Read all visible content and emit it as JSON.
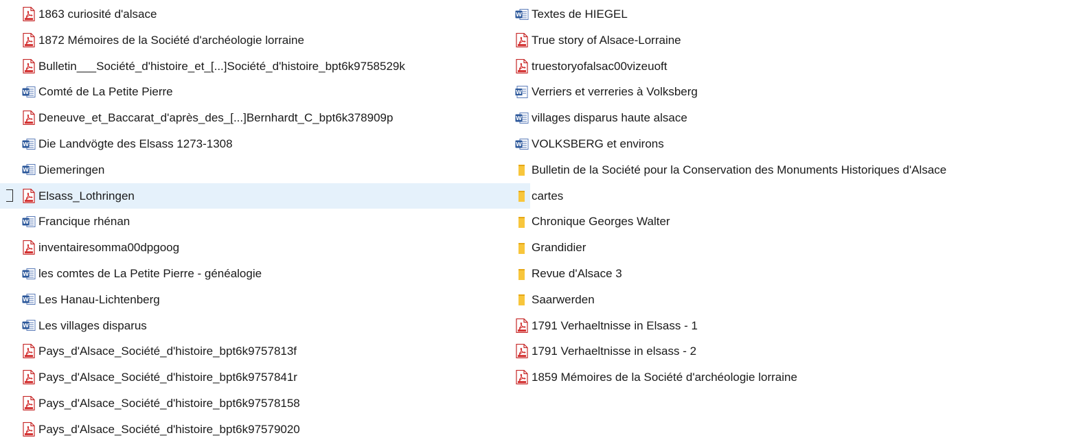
{
  "left_column": [
    {
      "name": "1863 curiosité d'alsace",
      "type": "pdf",
      "icon": "pdf-icon"
    },
    {
      "name": "1872 Mémoires de la Société d'archéologie lorraine",
      "type": "pdf",
      "icon": "pdf-icon"
    },
    {
      "name": "Bulletin___Société_d'histoire_et_[...]Société_d'histoire_bpt6k9758529k",
      "type": "pdf",
      "icon": "pdf-icon"
    },
    {
      "name": "Comté de La Petite Pierre",
      "type": "word",
      "icon": "word-icon"
    },
    {
      "name": "Deneuve_et_Baccarat_d'après_des_[...]Bernhardt_C_bpt6k378909p",
      "type": "pdf",
      "icon": "pdf-icon"
    },
    {
      "name": "Die Landvögte des Elsass 1273-1308",
      "type": "word",
      "icon": "word-icon"
    },
    {
      "name": "Diemeringen",
      "type": "word",
      "icon": "word-icon"
    },
    {
      "name": "Elsass_Lothringen",
      "type": "pdf",
      "icon": "pdf-icon",
      "selected": true
    },
    {
      "name": "Francique rhénan",
      "type": "word",
      "icon": "word-icon"
    },
    {
      "name": "inventairesomma00dpgoog",
      "type": "pdf",
      "icon": "pdf-icon"
    },
    {
      "name": "les comtes de La Petite Pierre - généalogie",
      "type": "word",
      "icon": "word-icon"
    },
    {
      "name": "Les Hanau-Lichtenberg",
      "type": "word",
      "icon": "word-icon"
    },
    {
      "name": "Les villages disparus",
      "type": "word",
      "icon": "word-icon"
    },
    {
      "name": "Pays_d'Alsace_Société_d'histoire_bpt6k9757813f",
      "type": "pdf",
      "icon": "pdf-icon"
    },
    {
      "name": "Pays_d'Alsace_Société_d'histoire_bpt6k9757841r",
      "type": "pdf",
      "icon": "pdf-icon"
    },
    {
      "name": "Pays_d'Alsace_Société_d'histoire_bpt6k97578158",
      "type": "pdf",
      "icon": "pdf-icon"
    },
    {
      "name": "Pays_d'Alsace_Société_d'histoire_bpt6k97579020",
      "type": "pdf",
      "icon": "pdf-icon"
    }
  ],
  "right_column": [
    {
      "name": "Textes de HIEGEL",
      "type": "word",
      "icon": "word-icon"
    },
    {
      "name": "True story of Alsace-Lorraine",
      "type": "pdf",
      "icon": "pdf-icon"
    },
    {
      "name": "truestoryofalsac00vizeuoft",
      "type": "pdf",
      "icon": "pdf-icon"
    },
    {
      "name": "Verriers et verreries  à Volksberg",
      "type": "word-old",
      "icon": "word-doc-icon"
    },
    {
      "name": "villages disparus haute alsace",
      "type": "word",
      "icon": "word-icon"
    },
    {
      "name": "VOLKSBERG et environs",
      "type": "word",
      "icon": "word-icon"
    },
    {
      "name": "Bulletin de la Société pour la Conservation des Monuments Historiques d'Alsace",
      "type": "folder",
      "icon": "folder-icon"
    },
    {
      "name": "cartes",
      "type": "folder",
      "icon": "folder-icon"
    },
    {
      "name": "Chronique Georges Walter",
      "type": "folder",
      "icon": "folder-icon"
    },
    {
      "name": "Grandidier",
      "type": "folder",
      "icon": "folder-icon"
    },
    {
      "name": "Revue d'Alsace 3",
      "type": "folder",
      "icon": "folder-icon"
    },
    {
      "name": "Saarwerden",
      "type": "folder",
      "icon": "folder-icon"
    },
    {
      "name": "1791 Verhaeltnisse in Elsass - 1",
      "type": "pdf",
      "icon": "pdf-icon"
    },
    {
      "name": "1791 Verhaeltnisse in elsass - 2",
      "type": "pdf",
      "icon": "pdf-icon"
    },
    {
      "name": "1859 Mémoires de la Société d'archéologie lorraine",
      "type": "pdf",
      "icon": "pdf-icon"
    }
  ],
  "colors": {
    "selection": "#e5f1fb",
    "pdf_red": "#d32f2f",
    "word_blue": "#2b579a",
    "folder_yellow": "#f8c63c"
  }
}
